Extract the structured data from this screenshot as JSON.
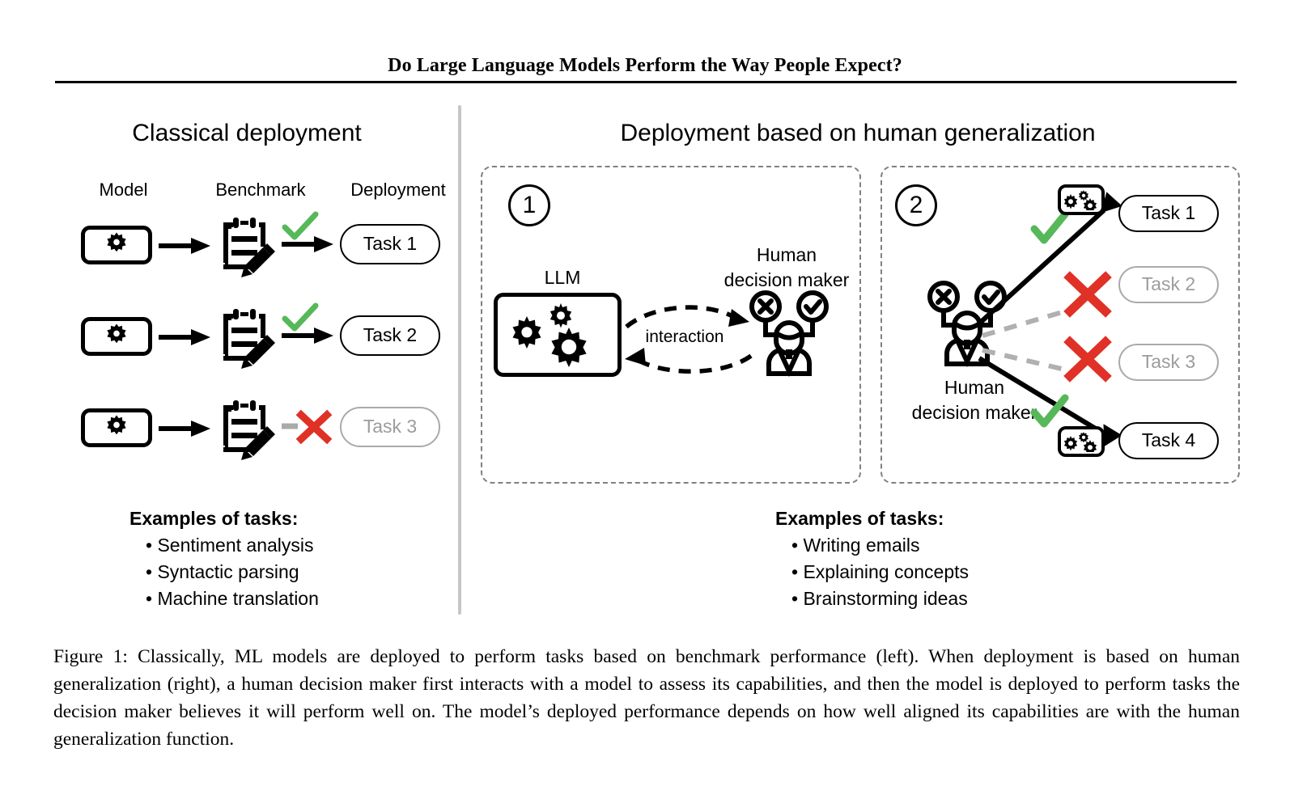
{
  "paper": {
    "title": "Do Large Language Models Perform the Way People Expect?"
  },
  "figure": {
    "left_panel": {
      "heading": "Classical deployment",
      "column_labels": {
        "model": "Model",
        "benchmark": "Benchmark",
        "deployment": "Deployment"
      },
      "rows": [
        {
          "task": "Task 1",
          "verdict": "check",
          "muted": false
        },
        {
          "task": "Task 2",
          "verdict": "check",
          "muted": false
        },
        {
          "task": "Task 3",
          "verdict": "cross",
          "muted": true
        }
      ],
      "examples": {
        "title": "Examples of tasks:",
        "items": [
          "Sentiment analysis",
          "Syntactic parsing",
          "Machine translation"
        ]
      }
    },
    "right_panel": {
      "heading": "Deployment based on human generalization",
      "step_1": {
        "badge": "1",
        "llm_label": "LLM",
        "interaction_label": "interaction",
        "human_label_line1": "Human",
        "human_label_line2": "decision maker"
      },
      "step_2": {
        "badge": "2",
        "human_label_line1": "Human",
        "human_label_line2": "decision maker",
        "tasks": [
          {
            "label": "Task 1",
            "verdict": "check",
            "muted": false,
            "edge": "solid"
          },
          {
            "label": "Task 2",
            "verdict": "cross",
            "muted": true,
            "edge": "dashed"
          },
          {
            "label": "Task 3",
            "verdict": "cross",
            "muted": true,
            "edge": "dashed"
          },
          {
            "label": "Task 4",
            "verdict": "check",
            "muted": false,
            "edge": "solid"
          }
        ]
      },
      "examples": {
        "title": "Examples of tasks:",
        "items": [
          "Writing emails",
          "Explaining concepts",
          "Brainstorming ideas"
        ]
      }
    },
    "caption": "Figure 1: Classically, ML models are deployed to perform tasks based on benchmark performance (left). When deployment is based on human generalization (right), a human decision maker first interacts with a model to assess its capabilities, and then the model is deployed to perform tasks the decision maker believes it will perform well on. The model’s deployed performance depends on how well aligned its capabilities are with the human generalization function."
  },
  "colors": {
    "check_green": "#57b85a",
    "cross_red": "#e03127",
    "muted_gray": "#aaaaaa",
    "divider_gray": "#c6c6c6",
    "panel_dash_gray": "#808080",
    "ink": "#000000"
  },
  "icons": {
    "model": "gear-icon",
    "benchmark": "clipboard-pencil-icon",
    "llm": "gears-icon",
    "human": "person-decision-maker-icon",
    "check": "check-icon",
    "cross": "cross-icon"
  }
}
